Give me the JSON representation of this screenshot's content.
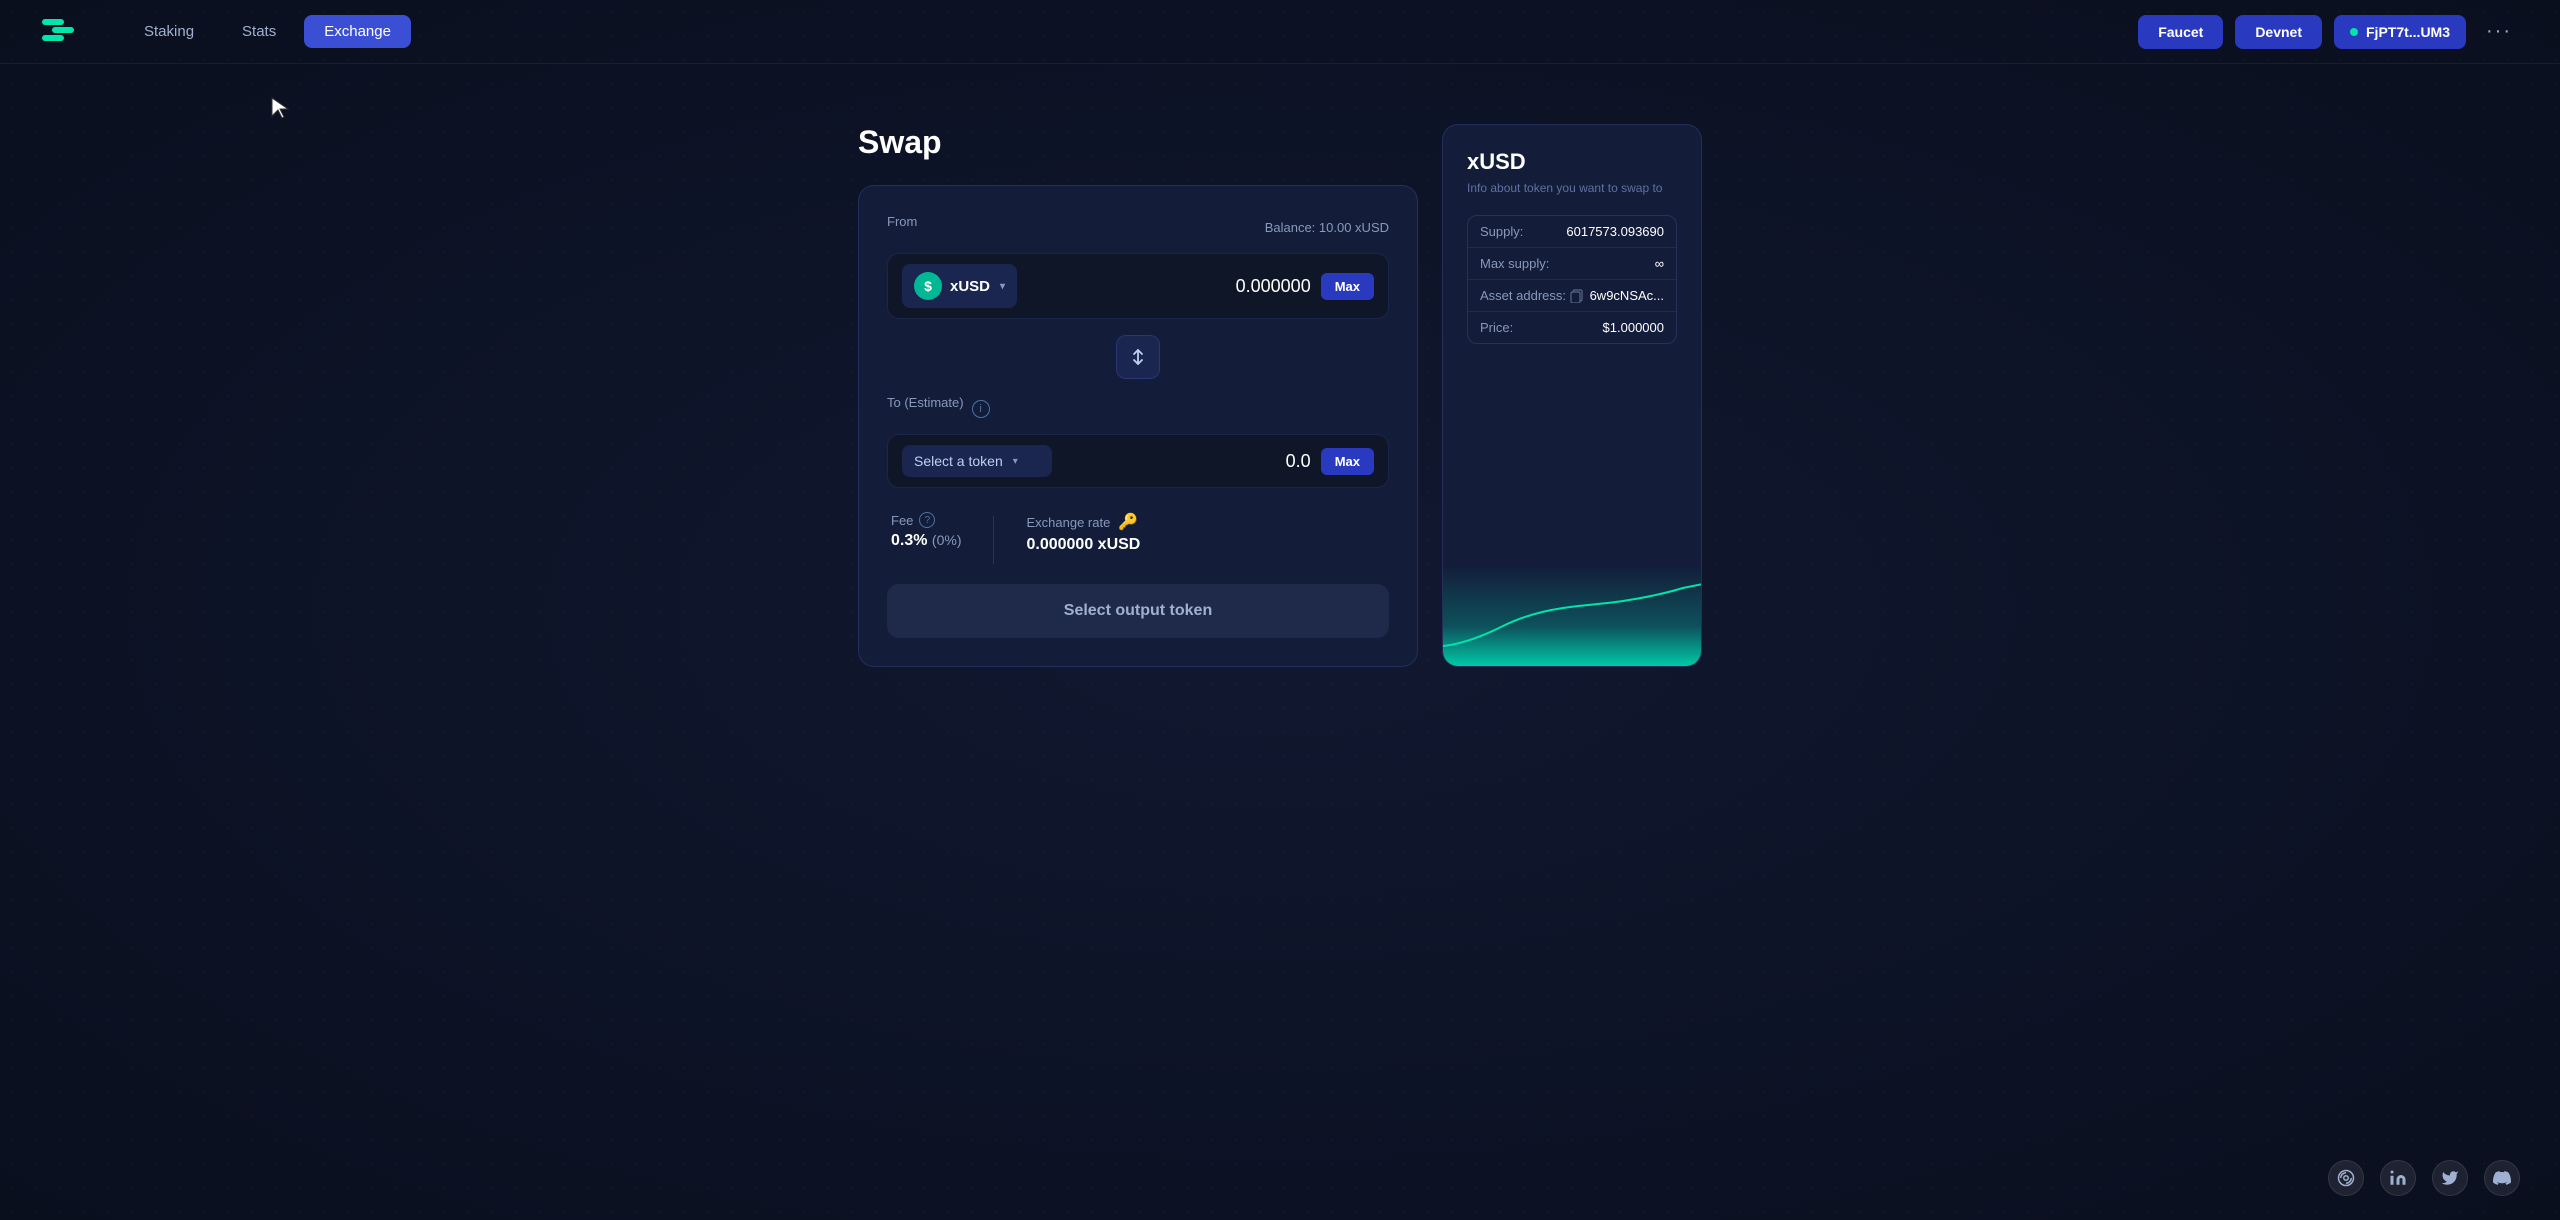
{
  "app": {
    "logo_text": "S"
  },
  "navbar": {
    "staking_label": "Staking",
    "stats_label": "Stats",
    "exchange_label": "Exchange",
    "faucet_label": "Faucet",
    "devnet_label": "Devnet",
    "wallet_address": "FjPT7t...UM3",
    "more_label": "···"
  },
  "page": {
    "title": "Swap"
  },
  "from_section": {
    "label": "From",
    "balance_label": "Balance: 10.00 xUSD",
    "token_name": "xUSD",
    "amount": "0.000000",
    "max_label": "Max"
  },
  "to_section": {
    "label": "To (Estimate)",
    "select_token_label": "Select a token",
    "amount": "0.0",
    "max_label": "Max"
  },
  "fee_section": {
    "label": "Fee",
    "value": "0.3%",
    "pct": "(0%)"
  },
  "exchange_rate_section": {
    "label": "Exchange rate",
    "value": "0.000000 xUSD"
  },
  "select_output_label": "Select output token",
  "info_card": {
    "title": "xUSD",
    "subtitle": "Info about token you want to swap to",
    "supply_label": "Supply:",
    "supply_value": "6017573.093690",
    "max_supply_label": "Max supply:",
    "max_supply_value": "∞",
    "asset_address_label": "Asset address:",
    "asset_address_value": "6w9cNSAc...",
    "price_label": "Price:",
    "price_value": "$1.000000"
  }
}
